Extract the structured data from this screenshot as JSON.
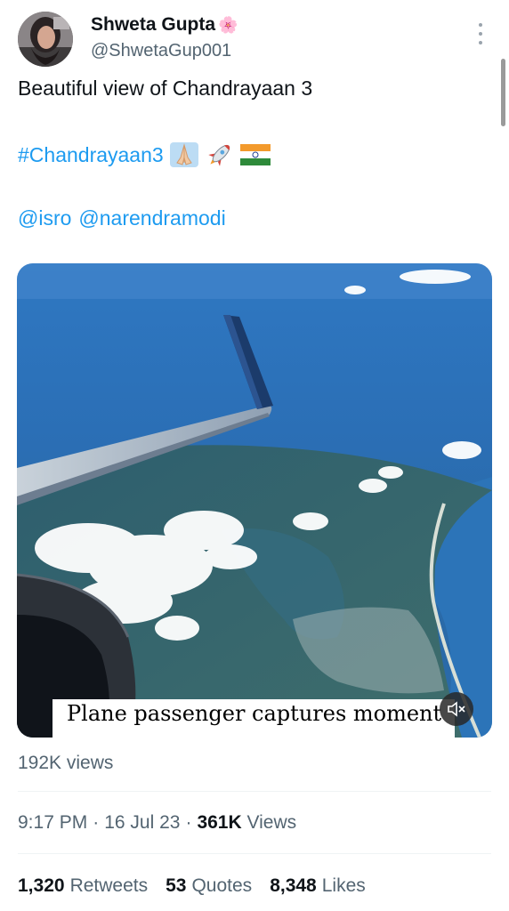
{
  "author": {
    "name": "Shweta Gupta",
    "name_emoji": "🌸",
    "handle": "@ShwetaGup001"
  },
  "tweet": {
    "text": "Beautiful view of Chandrayaan 3",
    "hashtag": "#Chandrayaan3",
    "hashtag_emojis": [
      "🙏🏻",
      "🚀",
      "🇮🇳"
    ],
    "mentions": [
      "@isro",
      "@narendramodi"
    ]
  },
  "media": {
    "caption": "Plane passenger captures moment",
    "mute_icon": "speaker-muted-icon"
  },
  "video_views": "192K views",
  "meta": {
    "time": "9:17 PM",
    "date": "16 Jul 23",
    "views_count": "361K",
    "views_label": "Views"
  },
  "stats": {
    "retweets_count": "1,320",
    "retweets_label": "Retweets",
    "quotes_count": "53",
    "quotes_label": "Quotes",
    "likes_count": "8,348",
    "likes_label": "Likes"
  },
  "colors": {
    "link": "#1d9bf0",
    "secondary_text": "#536471",
    "primary_text": "#0f1419"
  }
}
